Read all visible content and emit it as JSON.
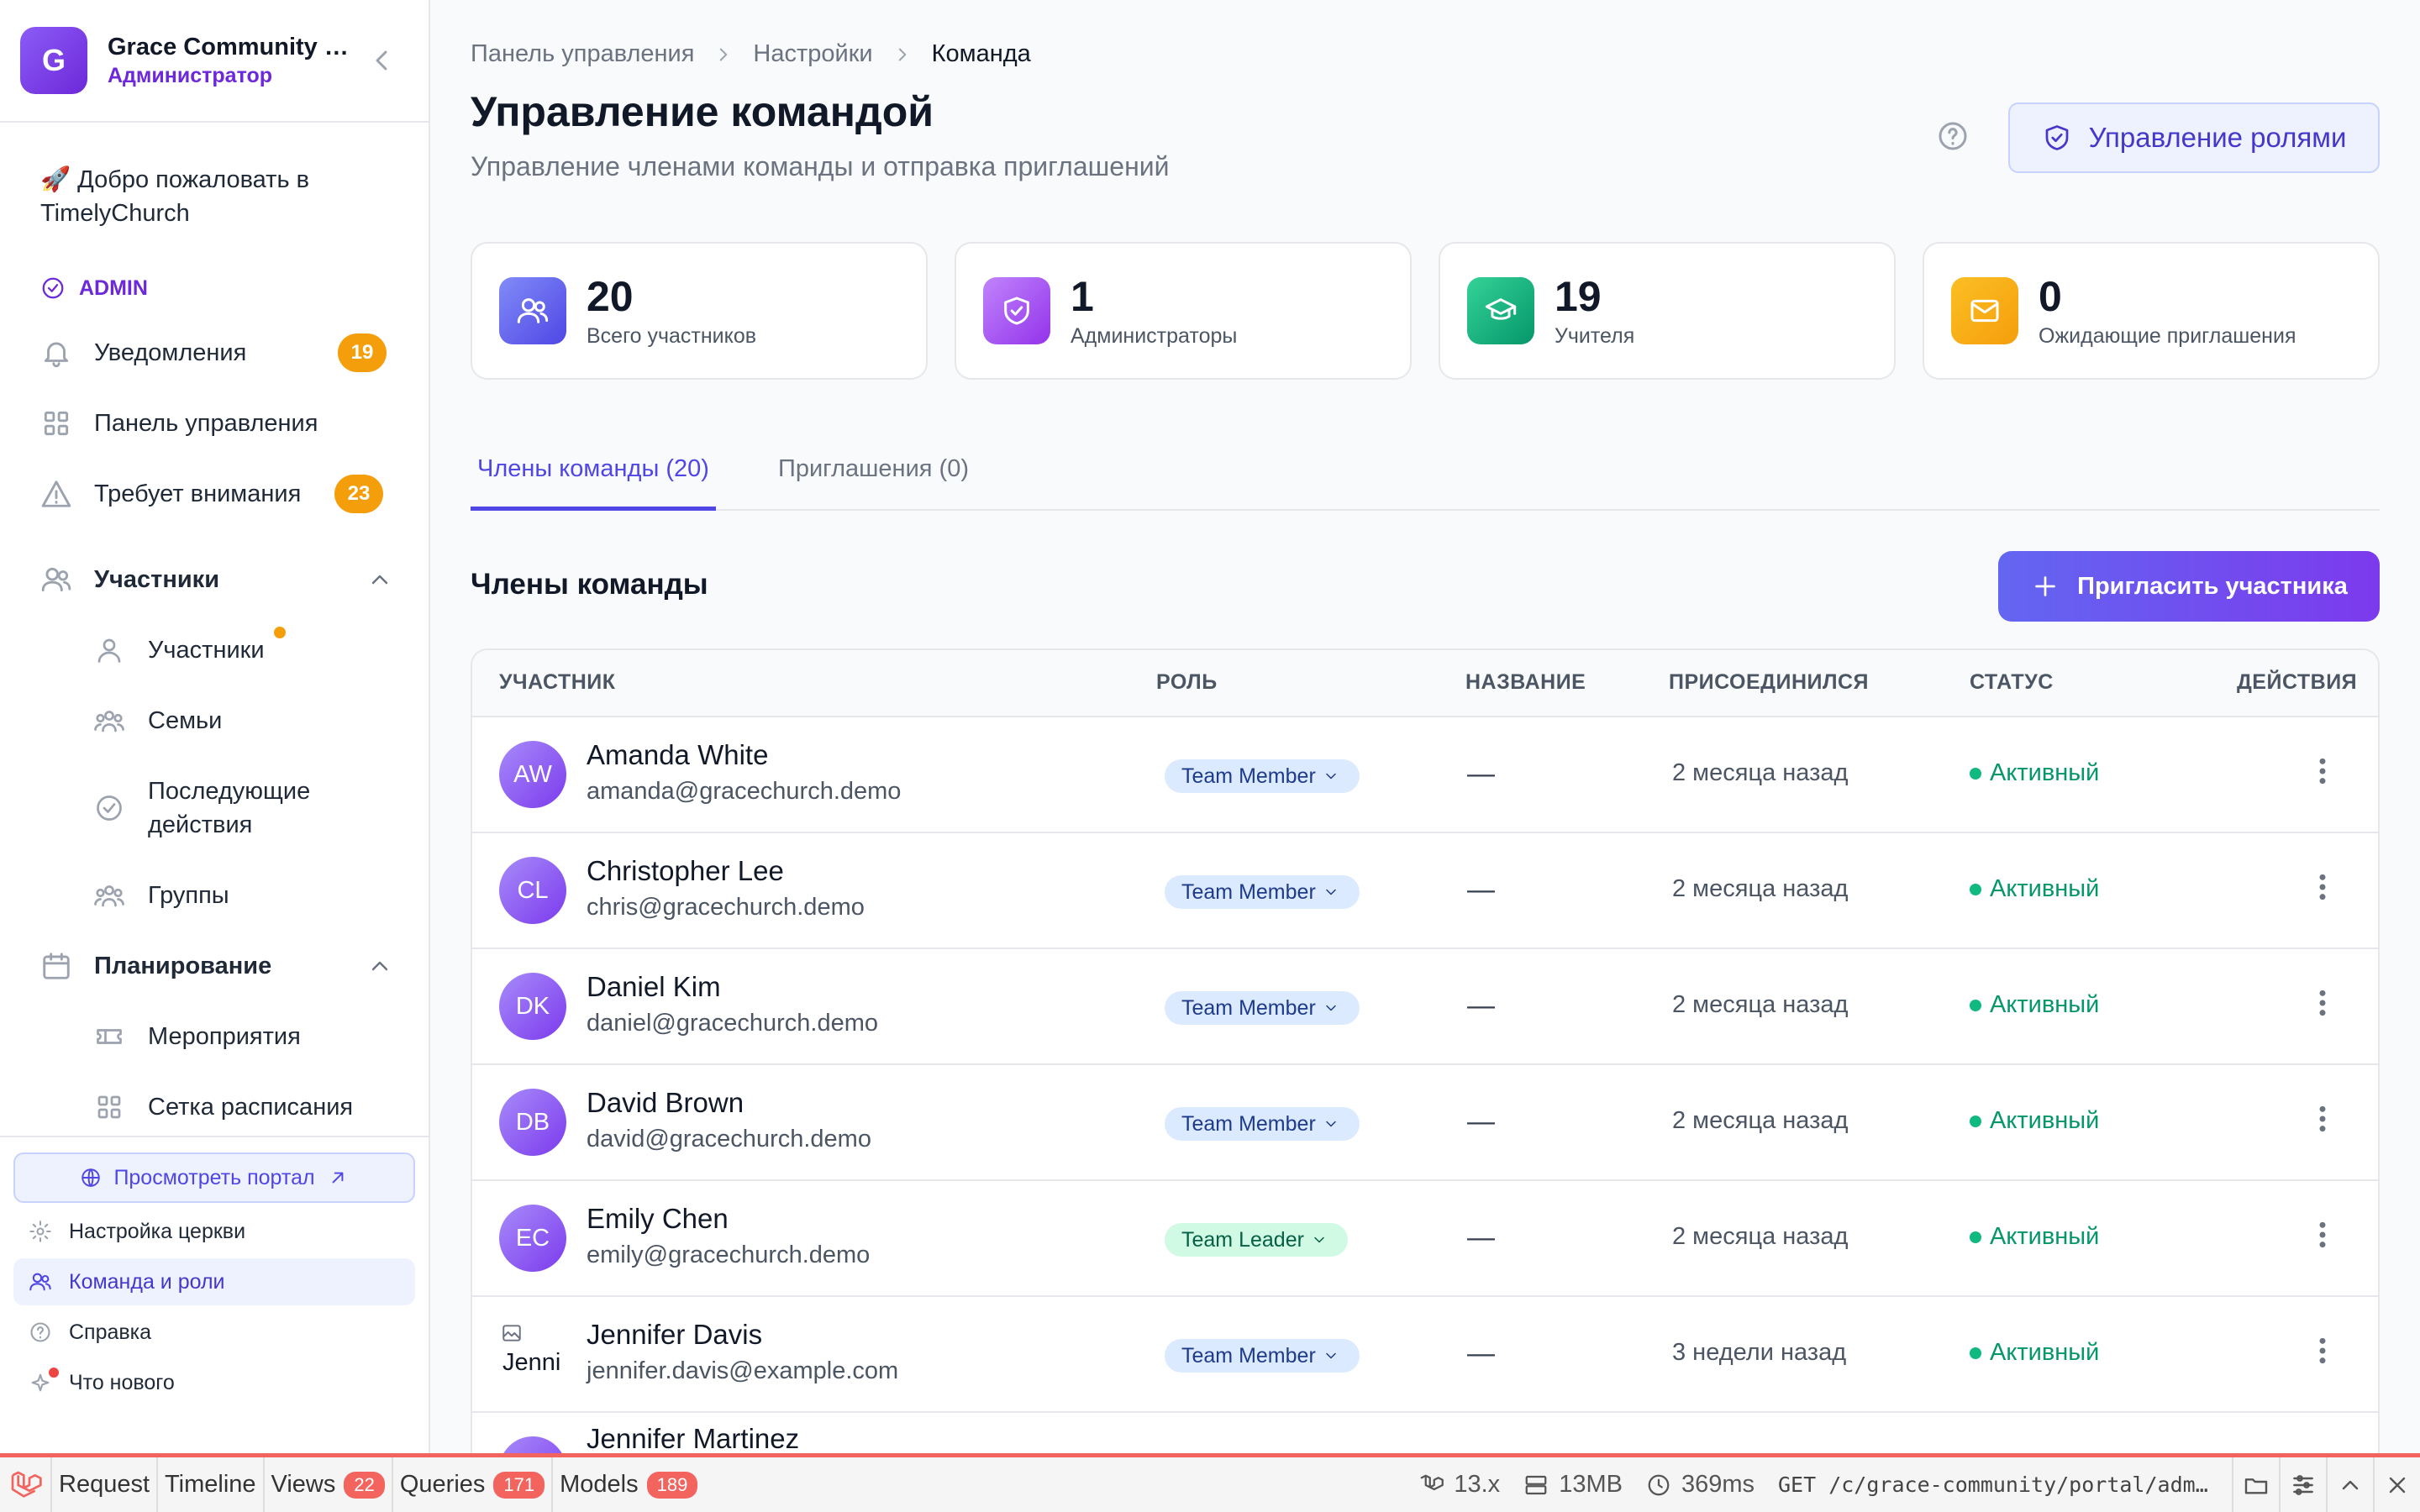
{
  "org": {
    "initial": "G",
    "name": "Grace Community Church",
    "role": "Администратор"
  },
  "sidebar": {
    "welcome": "🚀 Добро пожаловать в TimelyChurch",
    "admin_label": "ADMIN",
    "notifications": {
      "label": "Уведомления",
      "badge": "19"
    },
    "dashboard": "Панель управления",
    "attention": {
      "label": "Требует внимания",
      "badge": "23"
    },
    "members_section": "Участники",
    "members_items": [
      "Участники",
      "Семьи",
      "Последующие действия",
      "Группы"
    ],
    "planning_section": "Планирование",
    "planning_items": [
      "Мероприятия",
      "Сетка расписания"
    ],
    "footer": {
      "portal": "Просмотреть портал",
      "church_setup": "Настройка церкви",
      "team_roles": "Команда и роли",
      "help": "Справка",
      "whats_new": "Что нового"
    }
  },
  "breadcrumb": [
    "Панель управления",
    "Настройки",
    "Команда"
  ],
  "page": {
    "title": "Управление командой",
    "subtitle": "Управление членами команды и отправка приглашений",
    "roles_button": "Управление ролями"
  },
  "stats": [
    {
      "value": "20",
      "label": "Всего участников",
      "color": "#6366f1"
    },
    {
      "value": "1",
      "label": "Администраторы",
      "color": "#a855f7"
    },
    {
      "value": "19",
      "label": "Учителя",
      "color": "#10b981"
    },
    {
      "value": "0",
      "label": "Ожидающие приглашения",
      "color": "#f59e0b"
    }
  ],
  "tabs": {
    "members": "Члены команды (20)",
    "invites": "Приглашения (0)"
  },
  "section": {
    "title": "Члены команды",
    "invite_button": "Пригласить участника"
  },
  "table": {
    "headers": {
      "member": "УЧАСТНИК",
      "role": "РОЛЬ",
      "title": "НАЗВАНИЕ",
      "joined": "ПРИСОЕДИНИЛСЯ",
      "status": "СТАТУС",
      "actions": "ДЕЙСТВИЯ"
    },
    "rows": [
      {
        "initials": "AW",
        "name": "Amanda White",
        "email": "amanda@gracechurch.demo",
        "role": "Team Member",
        "title": "—",
        "joined": "2 месяца назад",
        "status": "Активный"
      },
      {
        "initials": "CL",
        "name": "Christopher Lee",
        "email": "chris@gracechurch.demo",
        "role": "Team Member",
        "title": "—",
        "joined": "2 месяца назад",
        "status": "Активный"
      },
      {
        "initials": "DK",
        "name": "Daniel Kim",
        "email": "daniel@gracechurch.demo",
        "role": "Team Member",
        "title": "—",
        "joined": "2 месяца назад",
        "status": "Активный"
      },
      {
        "initials": "DB",
        "name": "David Brown",
        "email": "david@gracechurch.demo",
        "role": "Team Member",
        "title": "—",
        "joined": "2 месяца назад",
        "status": "Активный"
      },
      {
        "initials": "EC",
        "name": "Emily Chen",
        "email": "emily@gracechurch.demo",
        "role": "Team Leader",
        "title": "—",
        "joined": "2 месяца назад",
        "status": "Активный"
      },
      {
        "initials": "Jenni",
        "name": "Jennifer Davis",
        "email": "jennifer.davis@example.com",
        "role": "Team Member",
        "title": "—",
        "joined": "3 недели назад",
        "status": "Активный"
      },
      {
        "initials": "JM",
        "name": "Jennifer Martinez",
        "email": "",
        "role": "",
        "title": "",
        "joined": "",
        "status": ""
      }
    ]
  },
  "debugbar": {
    "tabs": [
      {
        "label": "Request"
      },
      {
        "label": "Timeline"
      },
      {
        "label": "Views",
        "count": "22"
      },
      {
        "label": "Queries",
        "count": "171"
      },
      {
        "label": "Models",
        "count": "189"
      }
    ],
    "version": "13.x",
    "memory": "13MB",
    "time": "369ms",
    "request": "GET /c/grace-community/portal/admin/settings/team"
  }
}
